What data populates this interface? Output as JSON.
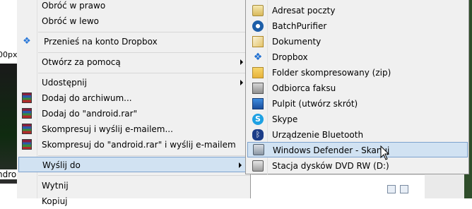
{
  "background": {
    "thumbnail_label": "00px",
    "android_label": "ndroi"
  },
  "main_menu": {
    "items": [
      {
        "label": "Obróć w prawo",
        "icon": ""
      },
      {
        "label": "Obróć w lewo",
        "icon": ""
      },
      {
        "label": "Przenieś na konto Dropbox",
        "icon": "dropbox-icon"
      },
      {
        "label": "Otwórz za pomocą",
        "icon": "",
        "submenu": true
      },
      {
        "label": "Udostępnij",
        "icon": "",
        "submenu": true
      },
      {
        "label": "Dodaj do archiwum...",
        "icon": "winrar-icon"
      },
      {
        "label": "Dodaj do \"android.rar\"",
        "icon": "winrar-icon"
      },
      {
        "label": "Skompresuj i wyślij e-mailem...",
        "icon": "winrar-icon"
      },
      {
        "label": "Skompresuj do \"android.rar\" i wyślij e-mailem",
        "icon": "winrar-icon"
      },
      {
        "label": "Wyślij do",
        "icon": "",
        "submenu": true,
        "highlighted": true
      },
      {
        "label": "Wytnij",
        "icon": ""
      },
      {
        "label": "Kopiuj",
        "icon": ""
      }
    ]
  },
  "send_to_menu": {
    "items": [
      {
        "label": "Adresat poczty",
        "icon": "mail-recipient-icon"
      },
      {
        "label": "BatchPurifier",
        "icon": "batchpurifier-icon"
      },
      {
        "label": "Dokumenty",
        "icon": "documents-icon"
      },
      {
        "label": "Dropbox",
        "icon": "dropbox-icon"
      },
      {
        "label": "Folder skompresowany (zip)",
        "icon": "zip-folder-icon"
      },
      {
        "label": "Odbiorca faksu",
        "icon": "fax-icon"
      },
      {
        "label": "Pulpit (utwórz skrót)",
        "icon": "desktop-icon"
      },
      {
        "label": "Skype",
        "icon": "skype-icon"
      },
      {
        "label": "Urządzenie Bluetooth",
        "icon": "bluetooth-icon"
      },
      {
        "label": "Windows Defender - Skanuj",
        "icon": "windows-defender-icon",
        "highlighted": true
      },
      {
        "label": "Stacja dysków DVD RW (D:)",
        "icon": "dvd-drive-icon"
      }
    ]
  },
  "colors": {
    "menu_bg": "#f0f0f0",
    "highlight_bg": "#d1e2f2",
    "highlight_border": "#7da2ce"
  }
}
